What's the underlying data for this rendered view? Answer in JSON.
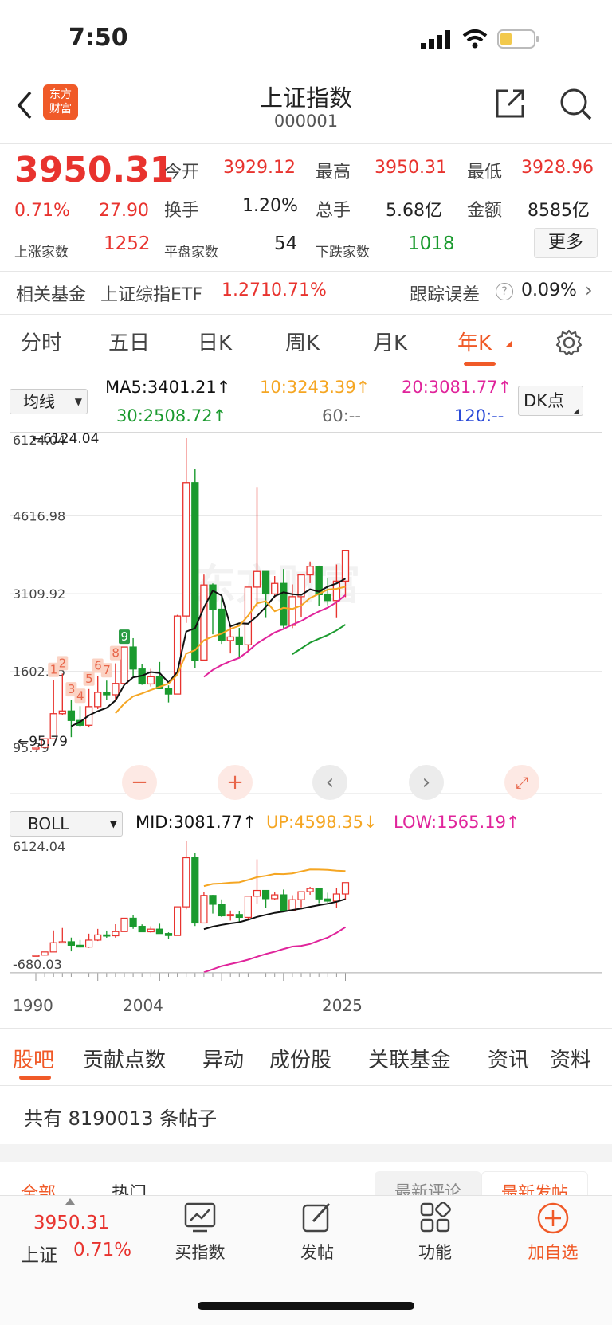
{
  "status_bar": {
    "time": "7:50"
  },
  "header": {
    "logo_line1": "东方",
    "logo_line2": "财富",
    "title": "上证指数",
    "code": "000001"
  },
  "quote": {
    "price": "3950.31",
    "change_pct": "0.71%",
    "change": "27.90",
    "open_label": "今开",
    "open": "3929.12",
    "high_label": "最高",
    "high": "3950.31",
    "low_label": "最低",
    "low": "3928.96",
    "turnover_label": "换手",
    "turnover": "1.20%",
    "volume_label": "总手",
    "volume": "5.68亿",
    "amount_label": "金额",
    "amount": "8585亿",
    "up_label": "上涨家数",
    "up": "1252",
    "flat_label": "平盘家数",
    "flat": "54",
    "down_label": "下跌家数",
    "down": "1018",
    "more": "更多"
  },
  "fund": {
    "label": "相关基金",
    "name": "上证综指ETF",
    "price": "1.271",
    "pct": "0.71%",
    "track_label": "跟踪误差",
    "track": "0.09%"
  },
  "tabs": [
    "分时",
    "五日",
    "日K",
    "周K",
    "月K",
    "年K"
  ],
  "ma": {
    "selector": "均线",
    "ma5": "MA5:3401.21↑",
    "ma10": "10:3243.39↑",
    "ma20": "20:3081.77↑",
    "ma30": "30:2508.72↑",
    "ma60": "60:--",
    "ma120": "120:--",
    "dk": "DK点"
  },
  "chart_main": {
    "ticks": [
      "6124.04",
      "4616.98",
      "3109.92",
      "1602.85",
      "95.79"
    ],
    "high_marker": "←6124.04",
    "low_marker": "←95.79",
    "watermark": "东方财富",
    "sequence_labels": [
      "1",
      "2",
      "3",
      "4",
      "5",
      "6",
      "7",
      "8",
      "9"
    ]
  },
  "boll": {
    "selector": "BOLL",
    "mid": "MID:3081.77↑",
    "up": "UP:4598.35↓",
    "low": "LOW:1565.19↑",
    "ticks": [
      "6124.04",
      "-680.03"
    ]
  },
  "xaxis": [
    "1990",
    "2004",
    "2025"
  ],
  "sub_tabs": [
    "股吧",
    "贡献点数",
    "异动",
    "成份股",
    "关联基金",
    "资讯",
    "资料"
  ],
  "posts": {
    "count_text": "共有 8190013 条帖子",
    "filter_all": "全部",
    "filter_hot": "热门",
    "sort_comment": "最新评论",
    "sort_post": "最新发帖"
  },
  "bottom_nav": {
    "price": "3950.31",
    "name": "上证",
    "pct": "0.71%",
    "buy": "买指数",
    "post": "发帖",
    "func": "功能",
    "add": "加自选"
  },
  "colors": {
    "red": "#e8332e",
    "green": "#1a9a2e",
    "orange": "#f5a623",
    "pink": "#e0249b",
    "accent": "#f05a28"
  },
  "chart_data": [
    {
      "type": "candlestick",
      "title": "上证指数 年K",
      "x": [
        "1990",
        "1991",
        "1992",
        "1993",
        "1994",
        "1995",
        "1996",
        "1997",
        "1998",
        "1999",
        "2000",
        "2001",
        "2002",
        "2003",
        "2004",
        "2005",
        "2006",
        "2007",
        "2008",
        "2009",
        "2010",
        "2011",
        "2012",
        "2013",
        "2014",
        "2015",
        "2016",
        "2017",
        "2018",
        "2019",
        "2020",
        "2021",
        "2022",
        "2023",
        "2024",
        "2025"
      ],
      "ohlc": [
        [
          96,
          128,
          96,
          128
        ],
        [
          128,
          293,
          105,
          293
        ],
        [
          293,
          1429,
          293,
          780
        ],
        [
          780,
          1558,
          750,
          833
        ],
        [
          833,
          1052,
          325,
          648
        ],
        [
          648,
          926,
          524,
          555
        ],
        [
          555,
          1258,
          512,
          917
        ],
        [
          917,
          1510,
          870,
          1194
        ],
        [
          1194,
          1422,
          1043,
          1147
        ],
        [
          1147,
          1756,
          1047,
          1367
        ],
        [
          1367,
          2073,
          1361,
          2073
        ],
        [
          2073,
          2245,
          1514,
          1646
        ],
        [
          1646,
          1748,
          1339,
          1357
        ],
        [
          1357,
          1649,
          1307,
          1497
        ],
        [
          1497,
          1783,
          1259,
          1266
        ],
        [
          1266,
          1329,
          998,
          1161
        ],
        [
          1161,
          2698,
          1161,
          2675
        ],
        [
          2675,
          6124,
          2541,
          5262
        ],
        [
          5262,
          5522,
          1664,
          1821
        ],
        [
          1821,
          3478,
          1849,
          3277
        ],
        [
          3277,
          3306,
          2319,
          2808
        ],
        [
          2808,
          3067,
          2134,
          2199
        ],
        [
          2199,
          2478,
          1949,
          2269
        ],
        [
          2269,
          2444,
          1849,
          2116
        ],
        [
          2116,
          3239,
          1974,
          3235
        ],
        [
          3235,
          5178,
          2850,
          3539
        ],
        [
          3539,
          3539,
          2638,
          3104
        ],
        [
          3104,
          3450,
          3016,
          3307
        ],
        [
          3307,
          3587,
          2440,
          2494
        ],
        [
          2494,
          3288,
          2440,
          3050
        ],
        [
          3050,
          3474,
          2646,
          3473
        ],
        [
          3473,
          3732,
          3312,
          3640
        ],
        [
          3640,
          3652,
          2864,
          3089
        ],
        [
          3089,
          3419,
          2882,
          2975
        ],
        [
          2975,
          3674,
          2635,
          3352
        ],
        [
          3352,
          3950,
          3041,
          3950
        ]
      ],
      "moving_averages": {
        "MA5": 3401.21,
        "MA10": 3243.39,
        "MA20": 3081.77,
        "MA30": 2508.72
      },
      "ylim": [
        95.79,
        6124.04
      ]
    },
    {
      "type": "line",
      "title": "BOLL",
      "series": [
        {
          "name": "MID",
          "last": 3081.77
        },
        {
          "name": "UP",
          "last": 4598.35
        },
        {
          "name": "LOW",
          "last": 1565.19
        }
      ],
      "ylim": [
        -680.03,
        6124.04
      ]
    }
  ]
}
